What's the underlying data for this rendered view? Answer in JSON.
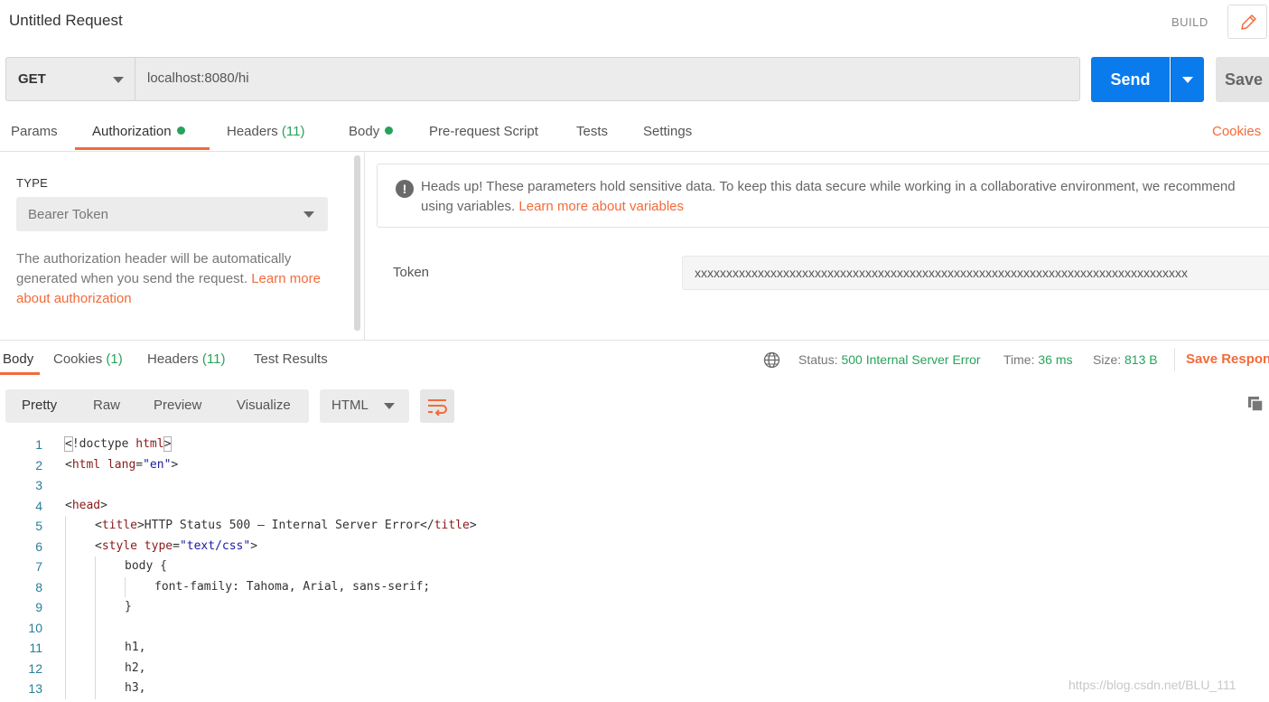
{
  "header": {
    "title": "Untitled Request",
    "build_label": "BUILD"
  },
  "request": {
    "method": "GET",
    "url": "localhost:8080/hi",
    "send_label": "Send",
    "save_label": "Save"
  },
  "request_tabs": {
    "params": "Params",
    "authorization": "Authorization",
    "headers": "Headers",
    "headers_count": "(11)",
    "body": "Body",
    "prerequest": "Pre-request Script",
    "tests": "Tests",
    "settings": "Settings",
    "cookies": "Cookies"
  },
  "auth": {
    "type_label": "TYPE",
    "type_value": "Bearer Token",
    "description": "The authorization header will be automatically generated when you send the request.",
    "learn_more": "Learn more about authorization",
    "headsup_text": "Heads up! These parameters hold sensitive data. To keep this data secure while working in a collaborative environment, we recommend using variables.",
    "headsup_link": "Learn more about variables",
    "token_label": "Token",
    "token_value": "xxxxxxxxxxxxxxxxxxxxxxxxxxxxxxxxxxxxxxxxxxxxxxxxxxxxxxxxxxxxxxxxxxxxxxxxxxxxxx"
  },
  "response_tabs": {
    "body": "Body",
    "cookies": "Cookies",
    "cookies_count": "(1)",
    "headers": "Headers",
    "headers_count": "(11)",
    "test_results": "Test Results"
  },
  "response_meta": {
    "status_label": "Status:",
    "status_value": "500 Internal Server Error",
    "time_label": "Time:",
    "time_value": "36 ms",
    "size_label": "Size:",
    "size_value": "813 B",
    "save_response": "Save Respon"
  },
  "response_view": {
    "pretty": "Pretty",
    "raw": "Raw",
    "preview": "Preview",
    "visualize": "Visualize",
    "language": "HTML"
  },
  "code_lines": [
    {
      "n": "1"
    },
    {
      "n": "2"
    },
    {
      "n": "3"
    },
    {
      "n": "4"
    },
    {
      "n": "5"
    },
    {
      "n": "6"
    },
    {
      "n": "7"
    },
    {
      "n": "8"
    },
    {
      "n": "9"
    },
    {
      "n": "10"
    },
    {
      "n": "11"
    },
    {
      "n": "12"
    },
    {
      "n": "13"
    }
  ],
  "code": {
    "l1_open": "<",
    "l1_doctype": "!doctype ",
    "l1_html": "html",
    "l1_close": ">",
    "l2_open": "<",
    "l2_tag": "html",
    "l2_attr": " lang",
    "l2_eq": "=",
    "l2_val": "\"en\"",
    "l2_close": ">",
    "l4_open": "<",
    "l4_tag": "head",
    "l4_close": ">",
    "l5_open": "<",
    "l5_tag": "title",
    "l5_close": ">",
    "l5_text": "HTTP Status 500 – Internal Server Error",
    "l5_end_open": "</",
    "l5_end_tag": "title",
    "l5_end_close": ">",
    "l6_open": "<",
    "l6_tag": "style",
    "l6_attr": " type",
    "l6_eq": "=",
    "l6_val": "\"text/css\"",
    "l6_close": ">",
    "l7": "body {",
    "l8": "font-family: Tahoma, Arial, sans-serif;",
    "l9": "}",
    "l11": "h1,",
    "l12": "h2,",
    "l13": "h3,"
  },
  "watermark": "https://blog.csdn.net/BLU_111",
  "colors": {
    "accent": "#f26b3a",
    "send": "#097bed",
    "success": "#26a35b"
  }
}
